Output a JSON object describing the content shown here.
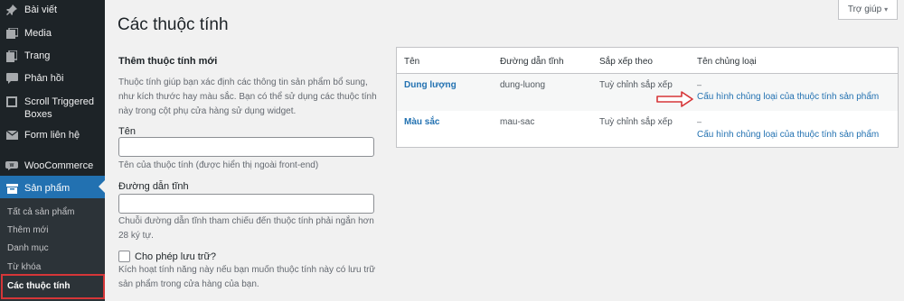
{
  "sidebar": {
    "items": [
      {
        "label": "Bài viết",
        "icon": "pin-icon"
      },
      {
        "label": "Media",
        "icon": "media-icon"
      },
      {
        "label": "Trang",
        "icon": "page-icon"
      },
      {
        "label": "Phản hồi",
        "icon": "comment-icon"
      },
      {
        "label": "Scroll Triggered Boxes",
        "icon": "box-icon"
      },
      {
        "label": "Form liên hệ",
        "icon": "mail-icon"
      },
      {
        "label": "WooCommerce",
        "icon": "woocommerce-icon"
      },
      {
        "label": "Sản phẩm",
        "icon": "archive-icon"
      }
    ],
    "submenu": [
      {
        "label": "Tất cả sản phẩm"
      },
      {
        "label": "Thêm mới"
      },
      {
        "label": "Danh mục"
      },
      {
        "label": "Từ khóa"
      },
      {
        "label": "Các thuộc tính"
      }
    ]
  },
  "header": {
    "title": "Các thuộc tính",
    "help_label": "Trợ giúp"
  },
  "form": {
    "heading": "Thêm thuộc tính mới",
    "intro": "Thuộc tính giúp bạn xác định các thông tin sản phẩm bổ sung, như kích thước hay màu sắc. Bạn có thể sử dụng các thuộc tính này trong cột phụ cửa hàng sử dụng widget.",
    "name_label": "Tên",
    "name_value": "",
    "name_help": "Tên của thuộc tính (được hiển thị ngoài front-end)",
    "slug_label": "Đường dẫn tĩnh",
    "slug_value": "",
    "slug_help": "Chuỗi đường dẫn tĩnh tham chiếu đến thuộc tính phải ngắn hơn 28 ký tự.",
    "archive_label": "Cho phép lưu trữ?",
    "archive_help": "Kích hoạt tính năng này nếu bạn muốn thuộc tính này có lưu trữ sản phẩm trong cửa hàng của bạn."
  },
  "table": {
    "headers": [
      "Tên",
      "Đường dẫn tĩnh",
      "Sắp xếp theo",
      "Tên chủng loại"
    ],
    "rows": [
      {
        "name": "Dung lượng",
        "slug": "dung-luong",
        "order": "Tuỳ chỉnh sắp xếp",
        "terms": "–",
        "configure": "Cấu hình chủng loại của thuộc tính sản phẩm"
      },
      {
        "name": "Màu sắc",
        "slug": "mau-sac",
        "order": "Tuỳ chỉnh sắp xếp",
        "terms": "–",
        "configure": "Cấu hình chủng loại của thuộc tính sản phẩm"
      }
    ]
  },
  "colors": {
    "sidebar_bg": "#1d2327",
    "accent": "#2271b1",
    "highlight": "#d63638"
  }
}
